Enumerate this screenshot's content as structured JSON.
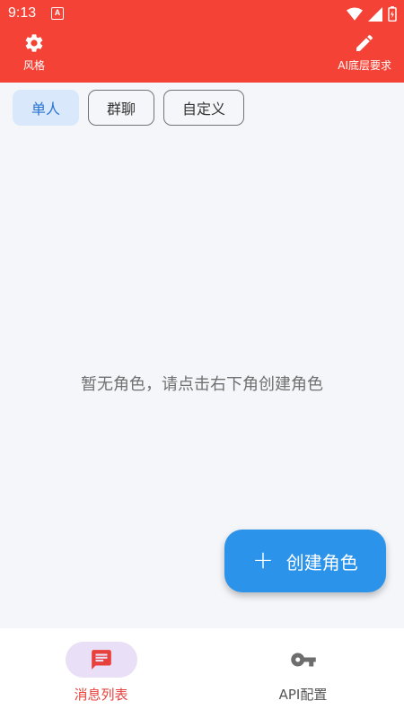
{
  "status": {
    "time": "9:13",
    "notification_glyph": "A"
  },
  "appbar": {
    "left": {
      "label": "风格",
      "icon": "gear-icon"
    },
    "right": {
      "label": "AI底层要求",
      "icon": "pencil-icon"
    }
  },
  "tabs": [
    {
      "label": "单人",
      "active": true
    },
    {
      "label": "群聊",
      "active": false
    },
    {
      "label": "自定义",
      "active": false
    }
  ],
  "empty_text": "暂无角色，请点击右下角创建角色",
  "fab": {
    "label": "创建角色",
    "icon": "plus-icon"
  },
  "bottomnav": [
    {
      "label": "消息列表",
      "icon": "message-icon",
      "active": true
    },
    {
      "label": "API配置",
      "icon": "key-icon",
      "active": false
    }
  ],
  "colors": {
    "primary_red": "#f44336",
    "fab_blue": "#2b94ea",
    "active_tab_bg": "#d9e8fb",
    "active_tab_text": "#2a74d1",
    "nav_active_pill": "#e9dff6",
    "nav_active_text": "#e8413b"
  }
}
